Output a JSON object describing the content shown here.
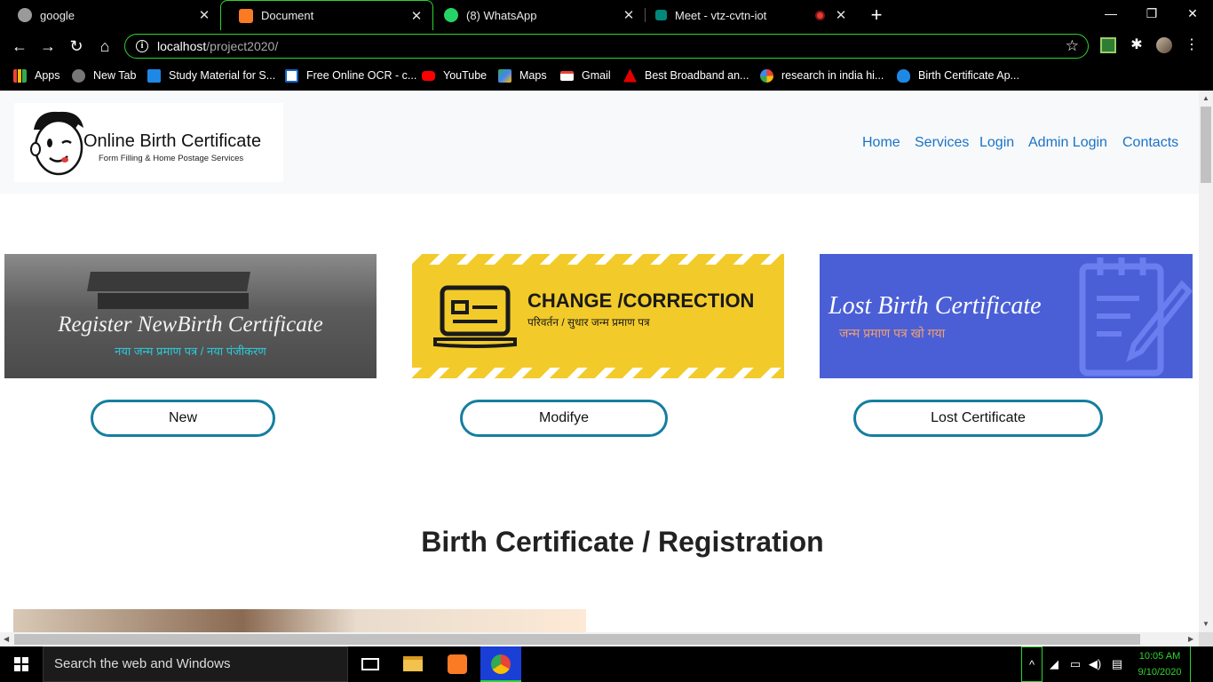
{
  "browser": {
    "tabs": [
      {
        "title": "google",
        "active": false
      },
      {
        "title": "Document",
        "active": true
      },
      {
        "title": "(8) WhatsApp",
        "active": false
      },
      {
        "title": "Meet - vtz-cvtn-iot",
        "active": false
      }
    ],
    "url_host": "localhost",
    "url_path": "/project2020/",
    "bookmarks": [
      "Apps",
      "New Tab",
      "Study Material for S...",
      "Free Online OCR - c...",
      "YouTube",
      "Maps",
      "Gmail",
      "Best Broadband an...",
      "research in india hi...",
      "Birth Certificate Ap..."
    ]
  },
  "site": {
    "logo_title": "Online Birth Certificate",
    "logo_subtitle": "Form Filling & Home Postage Services",
    "nav": [
      "Home",
      "Services",
      "Login",
      "Admin Login",
      "Contacts"
    ],
    "cards": [
      {
        "heading": "Register NewBirth Certificate",
        "subheading": "नया जन्म प्रमाण पत्र / नया पंजीकरण",
        "button": "New"
      },
      {
        "heading": "CHANGE /CORRECTION",
        "subheading": "परिवर्तन / सुधार जन्म प्रमाण पत्र",
        "button": "Modifye"
      },
      {
        "heading": "Lost Birth Certificate",
        "subheading": "जन्म प्रमाण पत्र खो गया",
        "button": "Lost Certificate"
      }
    ],
    "section_title": "Birth Certificate / Registration"
  },
  "taskbar": {
    "search_placeholder": "Search the web and Windows",
    "time": "10:05 AM",
    "date": "9/10/2020"
  },
  "colors": {
    "accent_green": "#2fd42f",
    "nav_link": "#1a73c8",
    "button_border": "#157ea0",
    "card_yellow": "#f2cb2a",
    "card_blue": "#4a5fd6"
  }
}
